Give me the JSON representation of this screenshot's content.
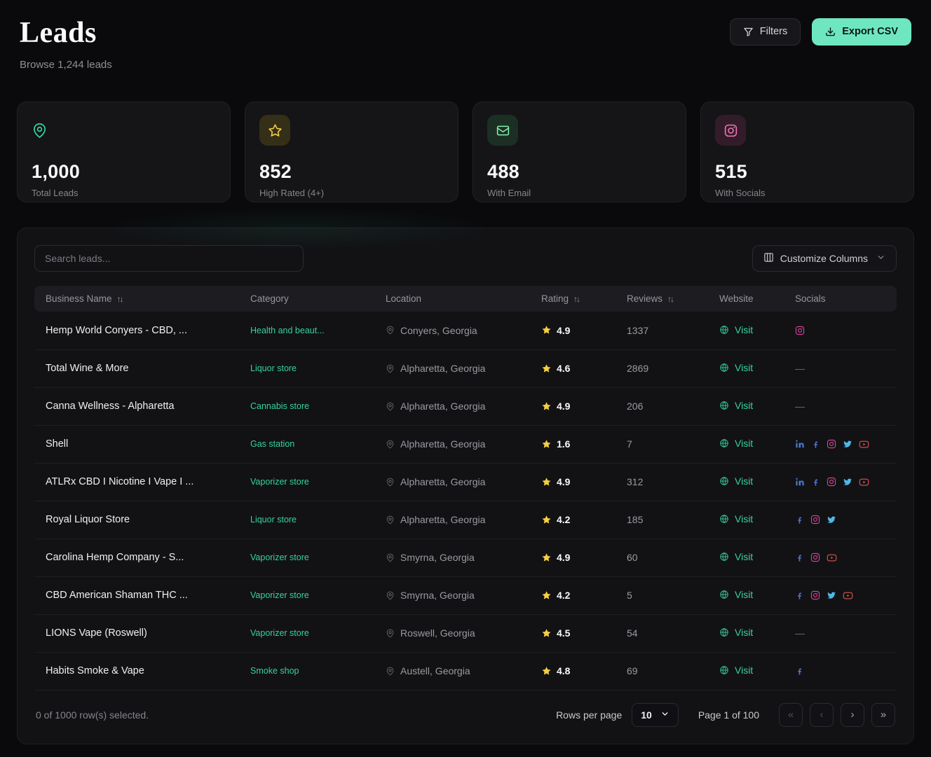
{
  "header": {
    "title": "Leads",
    "subtitle": "Browse 1,244 leads",
    "filters_label": "Filters",
    "export_label": "Export CSV",
    "accent_color": "#6ee7c0"
  },
  "stats": [
    {
      "icon": "map-pin-icon",
      "value": "1,000",
      "label": "Total Leads",
      "accent": "#34d399"
    },
    {
      "icon": "star-icon",
      "value": "852",
      "label": "High Rated (4+)",
      "accent": "#f5d14a"
    },
    {
      "icon": "mail-icon",
      "value": "488",
      "label": "With Email",
      "accent": "#86efac"
    },
    {
      "icon": "instagram-icon",
      "value": "515",
      "label": "With Socials",
      "accent": "#f472b6"
    }
  ],
  "table": {
    "search_placeholder": "Search leads...",
    "customize_label": "Customize Columns",
    "category_color": "#36d399",
    "rating_star_color": "#f5ce42",
    "columns": [
      {
        "label": "Business Name",
        "sortable": true
      },
      {
        "label": "Category",
        "sortable": false
      },
      {
        "label": "Location",
        "sortable": false
      },
      {
        "label": "Rating",
        "sortable": true
      },
      {
        "label": "Reviews",
        "sortable": true
      },
      {
        "label": "Website",
        "sortable": false
      },
      {
        "label": "Socials",
        "sortable": false
      }
    ],
    "visit_label": "Visit",
    "empty_socials": "—",
    "rows": [
      {
        "name": "Hemp World Conyers - CBD, ...",
        "category": "Health and beaut...",
        "location": "Conyers, Georgia",
        "rating": "4.9",
        "reviews": "1337",
        "socials": [
          "instagram"
        ]
      },
      {
        "name": "Total Wine & More",
        "category": "Liquor store",
        "location": "Alpharetta, Georgia",
        "rating": "4.6",
        "reviews": "2869",
        "socials": []
      },
      {
        "name": "Canna Wellness - Alpharetta",
        "category": "Cannabis store",
        "location": "Alpharetta, Georgia",
        "rating": "4.9",
        "reviews": "206",
        "socials": []
      },
      {
        "name": "Shell",
        "category": "Gas station",
        "location": "Alpharetta, Georgia",
        "rating": "1.6",
        "reviews": "7",
        "socials": [
          "linkedin",
          "facebook",
          "instagram",
          "twitter",
          "youtube"
        ]
      },
      {
        "name": "ATLRx CBD I Nicotine I Vape I ...",
        "category": "Vaporizer store",
        "location": "Alpharetta, Georgia",
        "rating": "4.9",
        "reviews": "312",
        "socials": [
          "linkedin",
          "facebook",
          "instagram",
          "twitter",
          "youtube"
        ]
      },
      {
        "name": "Royal Liquor Store",
        "category": "Liquor store",
        "location": "Alpharetta, Georgia",
        "rating": "4.2",
        "reviews": "185",
        "socials": [
          "facebook",
          "instagram",
          "twitter"
        ]
      },
      {
        "name": "Carolina Hemp Company - S...",
        "category": "Vaporizer store",
        "location": "Smyrna, Georgia",
        "rating": "4.9",
        "reviews": "60",
        "socials": [
          "facebook",
          "instagram",
          "youtube"
        ]
      },
      {
        "name": "CBD American Shaman THC ...",
        "category": "Vaporizer store",
        "location": "Smyrna, Georgia",
        "rating": "4.2",
        "reviews": "5",
        "socials": [
          "facebook",
          "instagram",
          "twitter",
          "youtube"
        ]
      },
      {
        "name": "LIONS Vape (Roswell)",
        "category": "Vaporizer store",
        "location": "Roswell, Georgia",
        "rating": "4.5",
        "reviews": "54",
        "socials": []
      },
      {
        "name": "Habits Smoke & Vape",
        "category": "Smoke shop",
        "location": "Austell, Georgia",
        "rating": "4.8",
        "reviews": "69",
        "socials": [
          "facebook"
        ]
      }
    ],
    "footer": {
      "selected_text": "0 of 1000 row(s) selected.",
      "rows_per_page_label": "Rows per page",
      "rows_per_page_value": "10",
      "page_text": "Page 1 of 100",
      "pager": {
        "first": "«",
        "prev": "‹",
        "next": "›",
        "last": "»"
      }
    }
  }
}
